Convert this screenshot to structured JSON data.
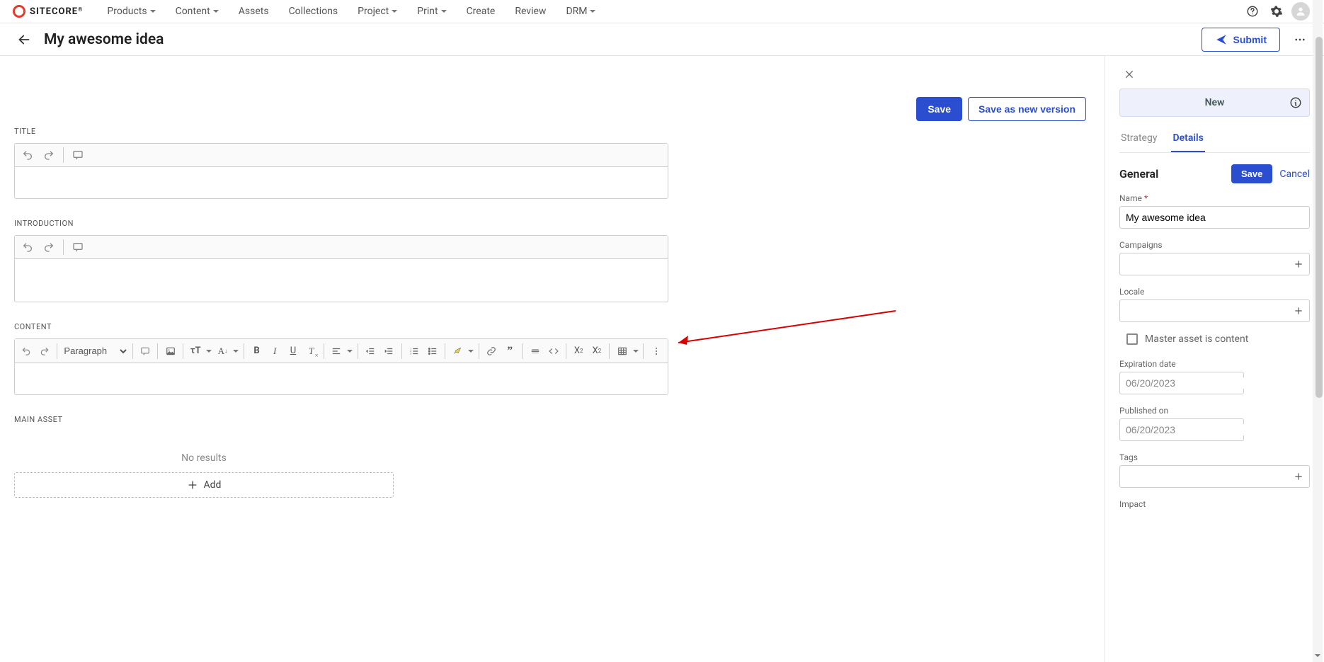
{
  "brand": "SITECORE",
  "nav": {
    "items": [
      {
        "label": "Products",
        "dropdown": true
      },
      {
        "label": "Content",
        "dropdown": true
      },
      {
        "label": "Assets",
        "dropdown": false
      },
      {
        "label": "Collections",
        "dropdown": false
      },
      {
        "label": "Project",
        "dropdown": true
      },
      {
        "label": "Print",
        "dropdown": true
      },
      {
        "label": "Create",
        "dropdown": false
      },
      {
        "label": "Review",
        "dropdown": false
      },
      {
        "label": "DRM",
        "dropdown": true
      }
    ]
  },
  "header": {
    "title": "My awesome idea",
    "submit": "Submit"
  },
  "main": {
    "save": "Save",
    "save_as_version": "Save as new version",
    "fields": {
      "title_label": "TITLE",
      "intro_label": "INTRODUCTION",
      "content_label": "CONTENT",
      "main_asset_label": "MAIN ASSET"
    },
    "paragraph_option": "Paragraph",
    "no_results": "No results",
    "add": "Add"
  },
  "panel": {
    "new": "New",
    "tabs": {
      "strategy": "Strategy",
      "details": "Details"
    },
    "section": "General",
    "save": "Save",
    "cancel": "Cancel",
    "name_label": "Name",
    "name_value": "My awesome idea",
    "campaigns_label": "Campaigns",
    "locale_label": "Locale",
    "master_asset_label": "Master asset is content",
    "expiration_label": "Expiration date",
    "published_label": "Published on",
    "date_placeholder": "06/20/2023",
    "tags_label": "Tags",
    "impact_label": "Impact"
  }
}
